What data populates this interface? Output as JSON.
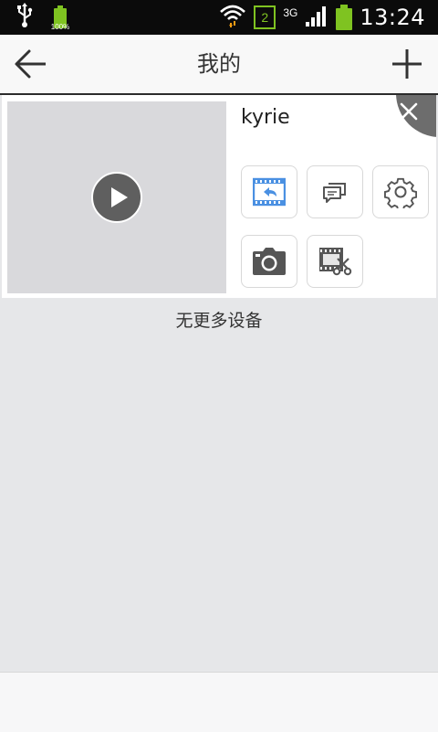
{
  "status_bar": {
    "time": "13:24",
    "battery_small_label": "100%",
    "sim_slot": "2",
    "network_type": "3G",
    "icons": [
      "usb-icon",
      "battery-icon",
      "wifi-icon",
      "sim-icon",
      "signal-icon",
      "battery-icon"
    ]
  },
  "appbar": {
    "title": "我的",
    "back_icon": "back-arrow-icon",
    "add_icon": "plus-icon"
  },
  "device_card": {
    "name": "kyrie",
    "thumbnail_watermark": "",
    "actions": [
      {
        "id": "playback",
        "icon": "playback-icon",
        "color": "#4a90e2"
      },
      {
        "id": "messages",
        "icon": "message-icon",
        "color": "#555555"
      },
      {
        "id": "settings",
        "icon": "gear-icon",
        "color": "#555555"
      },
      {
        "id": "snapshot",
        "icon": "camera-icon",
        "color": "#555555"
      },
      {
        "id": "clip",
        "icon": "film-scissors-icon",
        "color": "#555555"
      }
    ]
  },
  "list_footer": {
    "no_more_text": "无更多设备"
  }
}
